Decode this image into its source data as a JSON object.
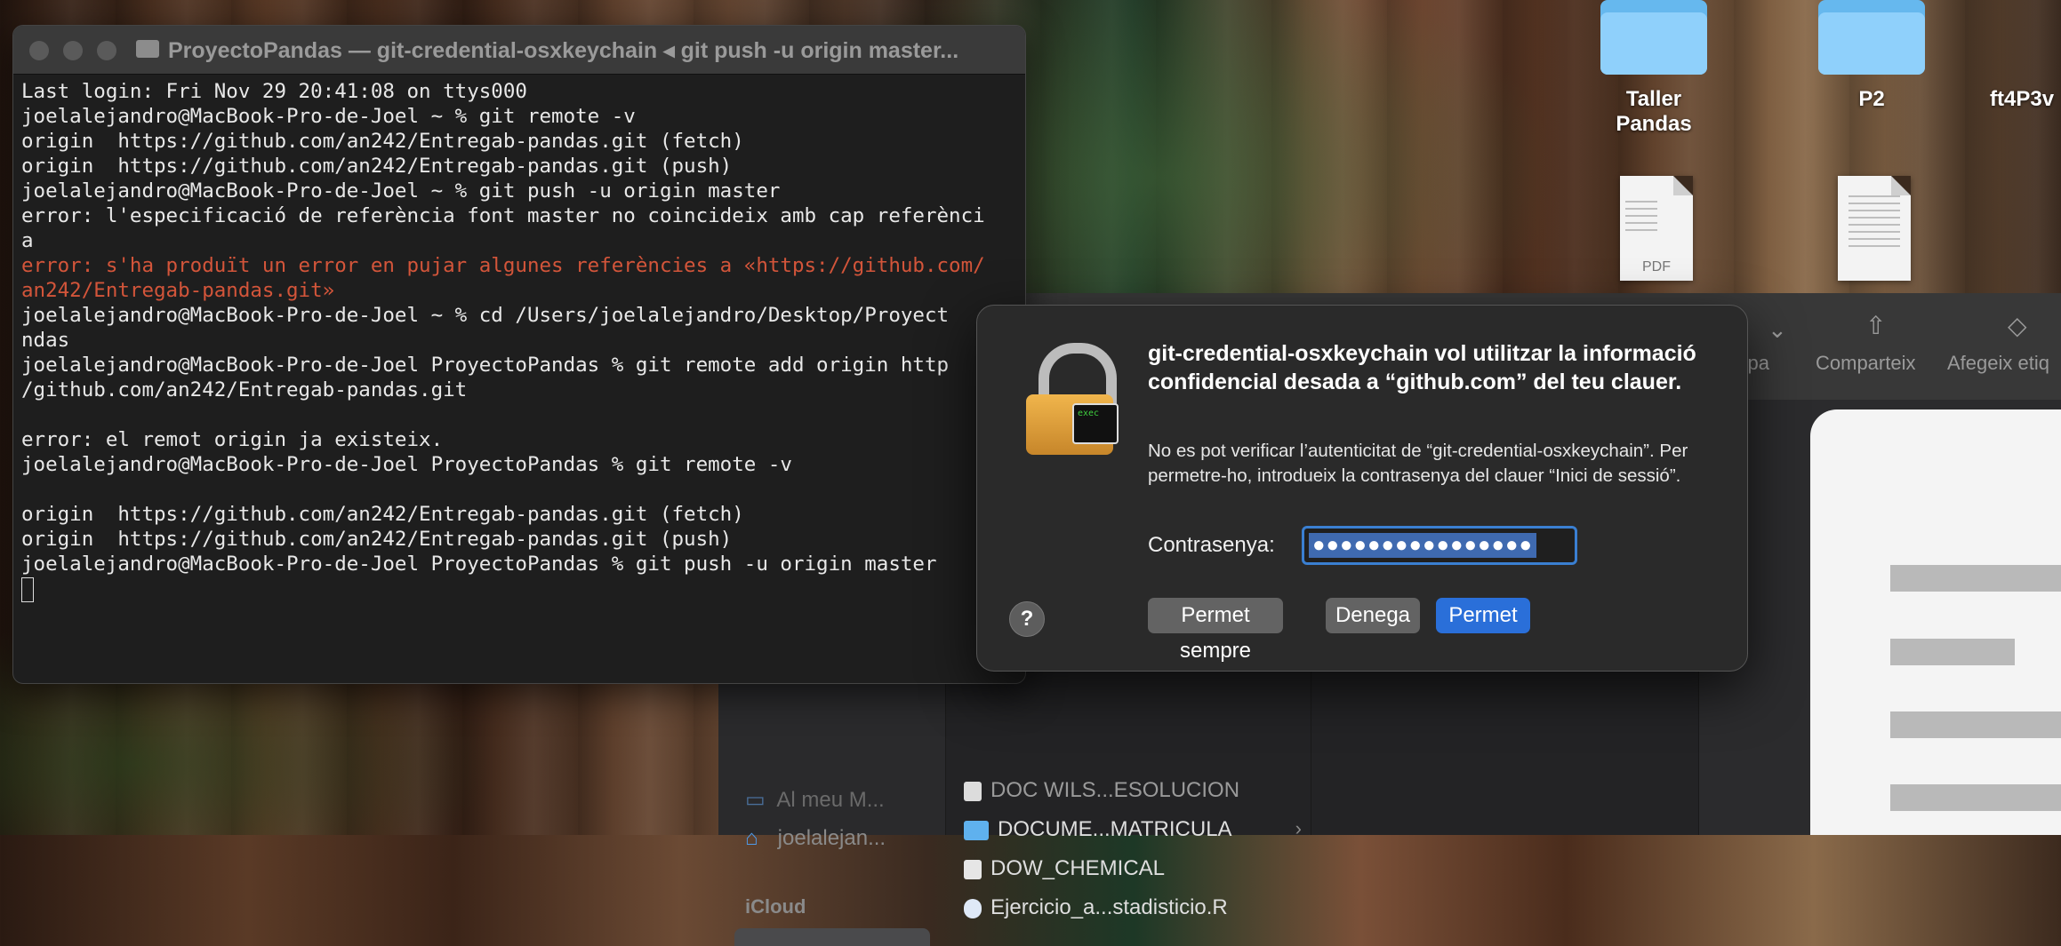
{
  "desktop": {
    "items": [
      {
        "label": "Taller Pandas",
        "kind": "folder"
      },
      {
        "label": "P2",
        "kind": "folder"
      },
      {
        "label": "ft4P3v",
        "kind": "folder-partial"
      },
      {
        "label": "",
        "kind": "pdf",
        "tag": "PDF"
      },
      {
        "label": "",
        "kind": "document"
      }
    ]
  },
  "terminal": {
    "title": "ProyectoPandas — git-credential-osxkeychain ◂ git push -u origin master...",
    "lines": [
      {
        "text": "Last login: Fri Nov 29 20:41:08 on ttys000",
        "style": "normal"
      },
      {
        "text": "joelalejandro@MacBook-Pro-de-Joel ~ % git remote -v",
        "style": "normal"
      },
      {
        "text": "origin  https://github.com/an242/Entregab-pandas.git (fetch)",
        "style": "normal"
      },
      {
        "text": "origin  https://github.com/an242/Entregab-pandas.git (push)",
        "style": "normal"
      },
      {
        "text": "joelalejandro@MacBook-Pro-de-Joel ~ % git push -u origin master",
        "style": "normal"
      },
      {
        "text": "error: l'especificació de referència font master no coincideix amb cap referènci",
        "style": "normal"
      },
      {
        "text": "a",
        "style": "normal"
      },
      {
        "text": "error: s'ha produït un error en pujar algunes referències a «https://github.com/",
        "style": "err"
      },
      {
        "text": "an242/Entregab-pandas.git»",
        "style": "err"
      },
      {
        "text": "joelalejandro@MacBook-Pro-de-Joel ~ % cd /Users/joelalejandro/Desktop/Proyect",
        "style": "normal"
      },
      {
        "text": "ndas",
        "style": "normal"
      },
      {
        "text": "joelalejandro@MacBook-Pro-de-Joel ProyectoPandas % git remote add origin http",
        "style": "normal"
      },
      {
        "text": "/github.com/an242/Entregab-pandas.git",
        "style": "normal"
      },
      {
        "text": "",
        "style": "normal"
      },
      {
        "text": "error: el remot origin ja existeix.",
        "style": "normal"
      },
      {
        "text": "joelalejandro@MacBook-Pro-de-Joel ProyectoPandas % git remote -v",
        "style": "normal"
      },
      {
        "text": "",
        "style": "normal"
      },
      {
        "text": "origin  https://github.com/an242/Entregab-pandas.git (fetch)",
        "style": "normal"
      },
      {
        "text": "origin  https://github.com/an242/Entregab-pandas.git (push)",
        "style": "normal"
      },
      {
        "text": "joelalejandro@MacBook-Pro-de-Joel ProyectoPandas % git push -u origin master",
        "style": "normal"
      }
    ],
    "colors": {
      "error": "#d3553a",
      "text": "#e8e8e8"
    }
  },
  "finder": {
    "toolbar": {
      "group_label": "rupa",
      "share_label": "Comparteix",
      "tags_label": "Afegeix etiq"
    },
    "sidebar": {
      "items": [
        {
          "label": "Al meu M...",
          "icon": "laptop-icon"
        },
        {
          "label": "joelalejan...",
          "icon": "home-icon"
        }
      ],
      "icloud_heading": "iCloud"
    },
    "list": [
      {
        "label": "DOC WILS...ESOLUCION",
        "icon": "document-icon",
        "dim": true
      },
      {
        "label": "DOCUME...MATRICULA",
        "icon": "folder-icon",
        "has_children": true
      },
      {
        "label": "DOW_CHEMICAL",
        "icon": "document-icon"
      },
      {
        "label": "Ejercicio_a...stadisticio.R",
        "icon": "r-file-icon"
      }
    ]
  },
  "dialog": {
    "title": "git-credential-osxkeychain vol utilitzar la informació confidencial desada a “github.com” del teu clauer.",
    "message": "No es pot verificar l’autenticitat de “git-credential-osxkeychain”. Per permetre-ho, introdueix la contrasenya del clauer “Inici de sessió”.",
    "password_label": "Contrasenya:",
    "password_value": "●●●●●●●●●●●●●●●●",
    "lock_badge": "exec",
    "help_label": "?",
    "buttons": {
      "always": "Permet sempre",
      "deny": "Denega",
      "allow": "Permet"
    },
    "colors": {
      "primary": "#2a6fd9",
      "focus_ring": "#3a7fd1"
    }
  }
}
